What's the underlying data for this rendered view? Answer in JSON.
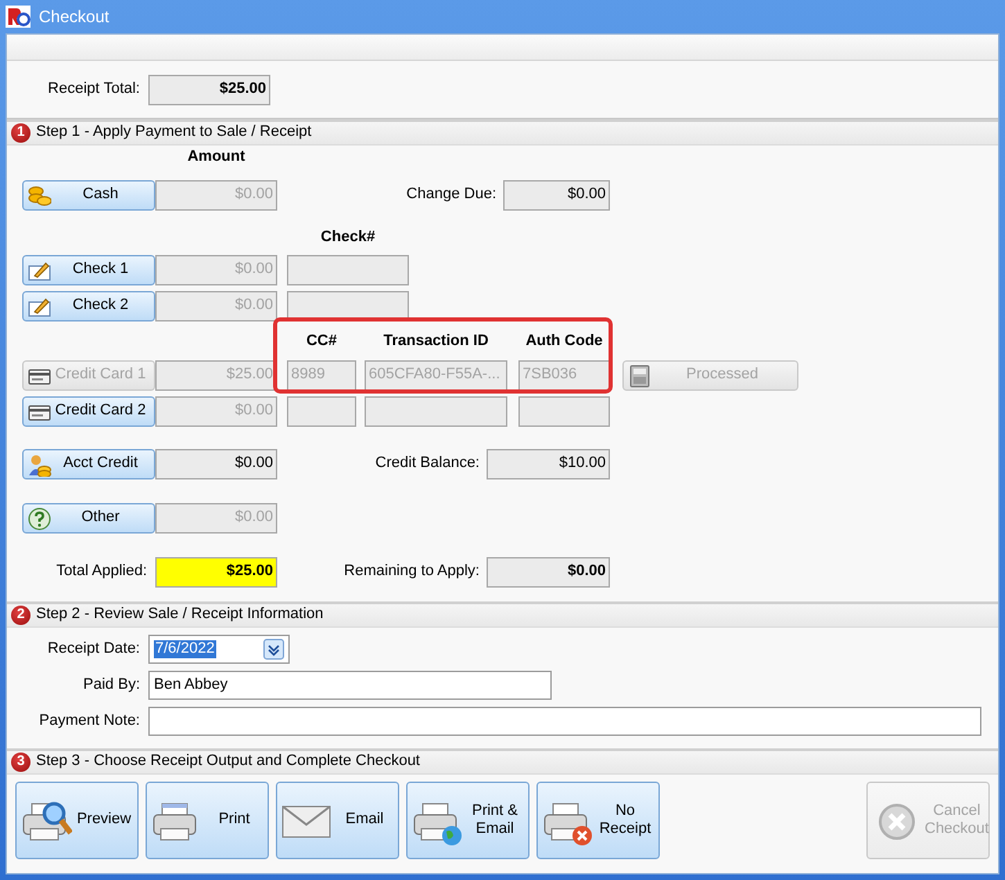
{
  "window": {
    "title": "Checkout"
  },
  "receipt_total": {
    "label": "Receipt Total:",
    "value": "$25.00"
  },
  "step1": {
    "number": "1",
    "title": "Step 1 - Apply Payment to Sale / Receipt",
    "amount_heading": "Amount",
    "cash": {
      "button": "Cash",
      "amount": "$0.00",
      "amount_disabled": true,
      "change_label": "Change Due:",
      "change_value": "$0.00"
    },
    "check_heading": "Check#",
    "checks": [
      {
        "button": "Check 1",
        "amount": "$0.00",
        "amount_disabled": true
      },
      {
        "button": "Check 2",
        "amount": "$0.00",
        "amount_disabled": true
      }
    ],
    "card_headings": {
      "cc": "CC#",
      "transaction_id": "Transaction ID",
      "auth_code": "Auth Code",
      "callout": true
    },
    "cards": [
      {
        "button": "Credit Card 1",
        "button_disabled": true,
        "amount": "$25.00",
        "amount_disabled": true,
        "cc": "8989",
        "transaction_id": "605CFA80-F55A-...",
        "auth_code": "7SB036",
        "status_button": "Processed",
        "status_disabled": true
      },
      {
        "button": "Credit Card 2",
        "button_disabled": false,
        "amount": "$0.00",
        "amount_disabled": true
      }
    ],
    "acct_credit": {
      "button": "Acct Credit",
      "amount": "$0.00",
      "amount_disabled": false,
      "balance_label": "Credit Balance:",
      "balance_value": "$10.00"
    },
    "other": {
      "button": "Other",
      "amount": "$0.00",
      "amount_disabled": true
    },
    "total_applied": {
      "label": "Total Applied:",
      "value": "$25.00",
      "highlighted": true
    },
    "remaining": {
      "label": "Remaining to Apply:",
      "value": "$0.00"
    }
  },
  "step2": {
    "number": "2",
    "title": "Step 2 - Review Sale / Receipt Information",
    "receipt_date": {
      "label": "Receipt Date:",
      "value": "7/6/2022",
      "selected": true
    },
    "paid_by": {
      "label": "Paid By:",
      "value": "Ben Abbey"
    },
    "payment_note": {
      "label": "Payment Note:"
    }
  },
  "step3": {
    "number": "3",
    "title": "Step 3 - Choose Receipt Output and Complete Checkout",
    "buttons": [
      {
        "kind": "preview",
        "label": "Preview",
        "disabled": false
      },
      {
        "kind": "print",
        "label": "Print",
        "disabled": false
      },
      {
        "kind": "email",
        "label": "Email",
        "disabled": false
      },
      {
        "kind": "print_email",
        "label": "Print & Email",
        "disabled": false
      },
      {
        "kind": "no_receipt",
        "label": "No Receipt",
        "disabled": false
      },
      {
        "kind": "cancel",
        "label": "Cancel Checkout",
        "disabled": true
      }
    ]
  }
}
